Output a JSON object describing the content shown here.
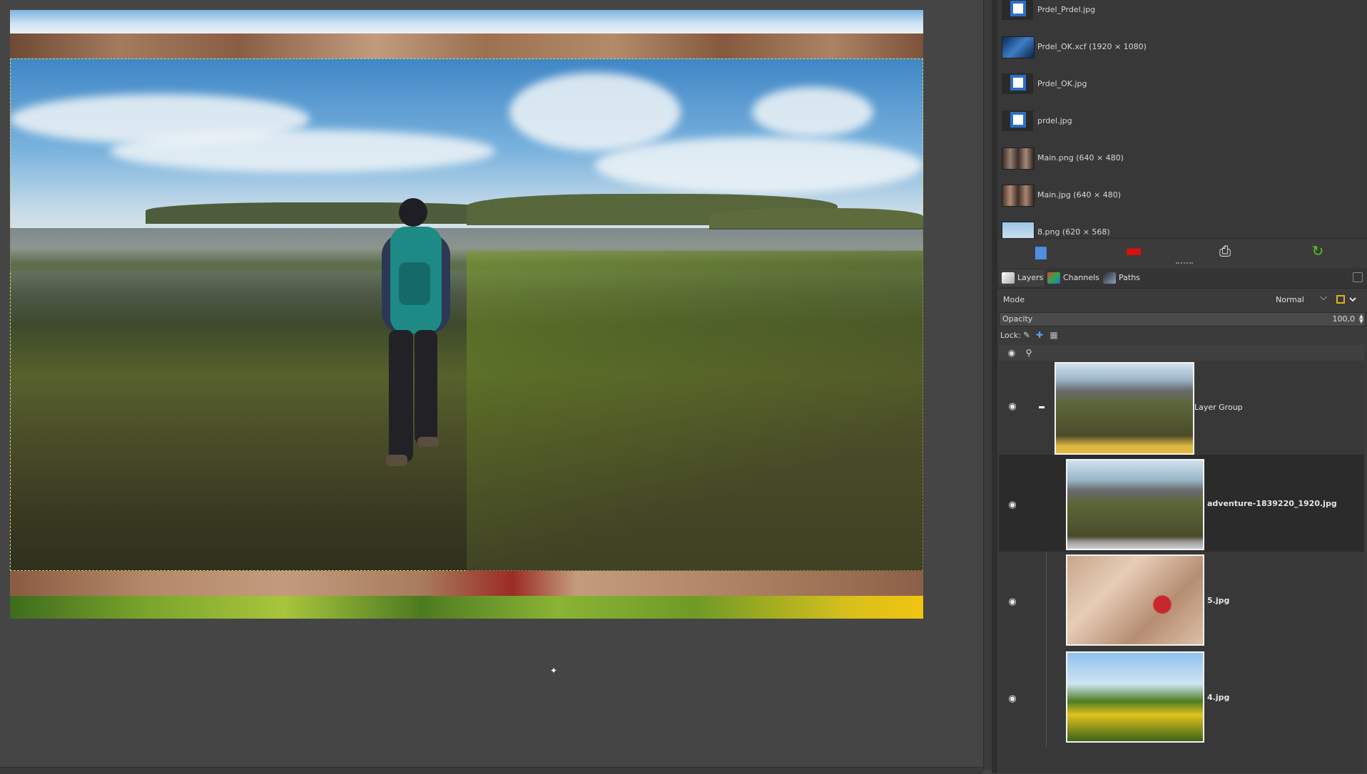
{
  "images_panel": {
    "items": [
      {
        "label": "Prdel_Prdel.jpg",
        "thumb": "doc"
      },
      {
        "label": "Prdel_OK.xcf (1920 × 1080)",
        "thumb": "photo-blue"
      },
      {
        "label": "Prdel_OK.jpg",
        "thumb": "doc"
      },
      {
        "label": "prdel.jpg",
        "thumb": "doc"
      },
      {
        "label": "Main.png (640 × 480)",
        "thumb": "photo-people"
      },
      {
        "label": "Main.jpg (640 × 480)",
        "thumb": "photo-people"
      },
      {
        "label": "8.png (620 × 568)",
        "thumb": "photo-sky"
      }
    ],
    "toolbar": {
      "open_icon": "open-image-icon",
      "delete_icon": "delete-icon",
      "print_icon": "print-icon",
      "refresh_icon": "refresh-icon"
    }
  },
  "tabs": [
    {
      "label": "Layers",
      "icon": "layers-icon",
      "color": "#d8d8d8"
    },
    {
      "label": "Channels",
      "icon": "channels-icon",
      "color": "#d23a3a"
    },
    {
      "label": "Paths",
      "icon": "paths-icon",
      "color": "#8aa0c0"
    }
  ],
  "layers_panel": {
    "mode_label": "Mode",
    "mode_value": "Normal",
    "opacity_label": "Opacity",
    "opacity_value": "100,0",
    "lock_label": "Lock:",
    "layers": [
      {
        "name": "Layer Group",
        "visible": true,
        "selected": false,
        "bold": false
      },
      {
        "name": "adventure-1839220_1920.jpg",
        "visible": true,
        "selected": true,
        "bold": true
      },
      {
        "name": "5.jpg",
        "visible": true,
        "selected": false,
        "bold": true
      },
      {
        "name": "4.jpg",
        "visible": true,
        "selected": false,
        "bold": true
      }
    ]
  },
  "colors": {
    "background": "#454545",
    "dock": "#3b3b3b",
    "selection": "#2b2b2b",
    "refresh_green": "#5cc21b",
    "delete_red": "#d81010",
    "open_blue": "#4f8fe0"
  }
}
